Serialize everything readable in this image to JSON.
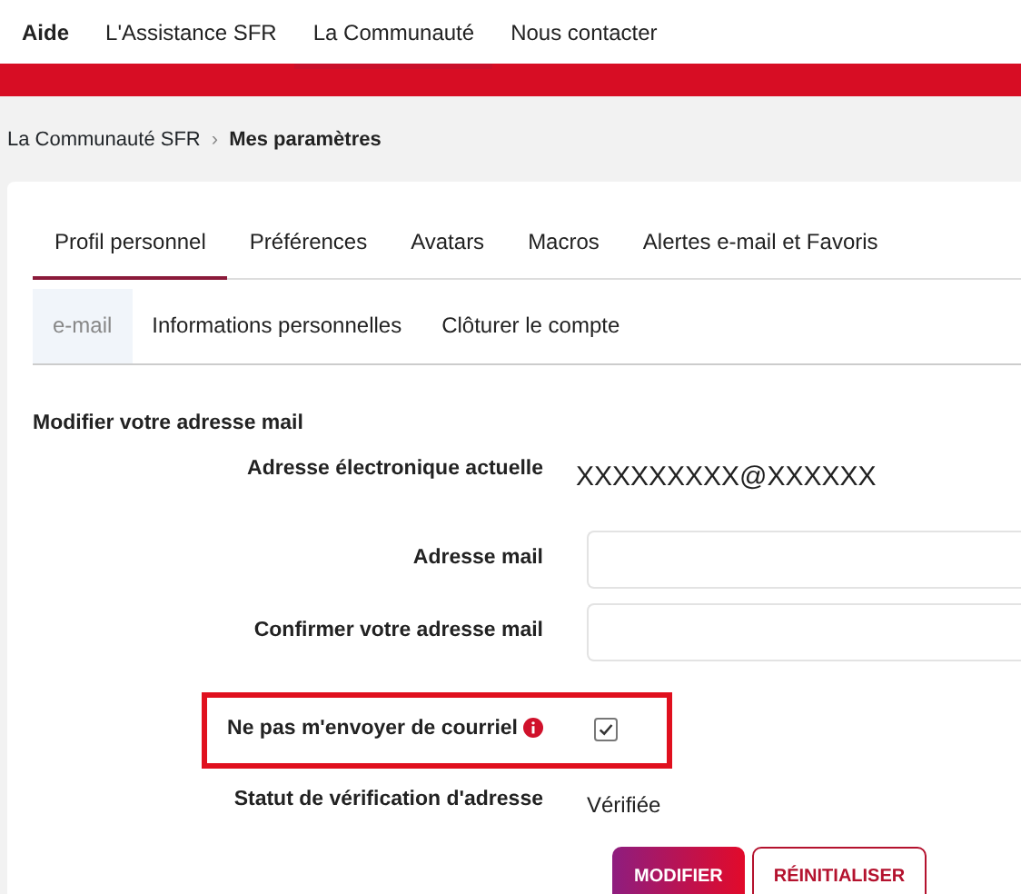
{
  "top_nav": [
    {
      "label": "Aide",
      "selected": false,
      "bold": true
    },
    {
      "label": "L'Assistance SFR",
      "selected": false,
      "bold": false
    },
    {
      "label": "La Communauté",
      "selected": true,
      "bold": false
    },
    {
      "label": "Nous contacter",
      "selected": false,
      "bold": false
    }
  ],
  "breadcrumb": {
    "items": [
      "La Communauté SFR"
    ],
    "separator": "›",
    "current": "Mes paramètres"
  },
  "tabs": [
    {
      "label": "Profil personnel",
      "selected": true
    },
    {
      "label": "Préférences",
      "selected": false
    },
    {
      "label": "Avatars",
      "selected": false
    },
    {
      "label": "Macros",
      "selected": false
    },
    {
      "label": "Alertes e-mail et Favoris",
      "selected": false
    }
  ],
  "subtabs": [
    {
      "label": "e-mail",
      "selected": true
    },
    {
      "label": "Informations personnelles",
      "selected": false
    },
    {
      "label": "Clôturer le compte",
      "selected": false
    }
  ],
  "section_title": "Modifier votre adresse mail",
  "rows": [
    {
      "kind": "text",
      "label": "Adresse électronique actuelle",
      "value": "XXXXXXXXX@XXXXXX"
    },
    {
      "kind": "input",
      "label": "Adresse mail"
    },
    {
      "kind": "input",
      "label": "Confirmer votre adresse mail"
    },
    {
      "kind": "checkbox",
      "label": "Ne pas m'envoyer de courriel",
      "checked": true,
      "info": true,
      "highlighted": true
    },
    {
      "kind": "status",
      "label": "Statut de vérification d'adresse",
      "value": "Vérifiée"
    }
  ],
  "buttons": [
    {
      "label": "MODIFIER",
      "kind": "primary"
    },
    {
      "label": "RÉINITIALISER",
      "kind": "secondary"
    }
  ]
}
